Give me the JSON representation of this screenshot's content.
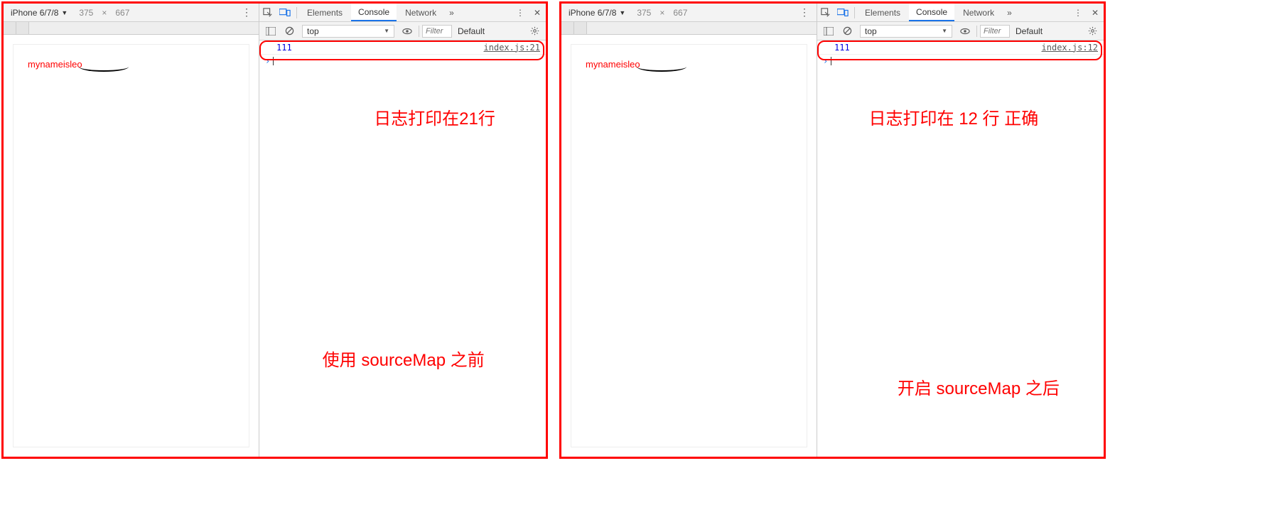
{
  "left": {
    "device_toolbar": {
      "device_name": "iPhone 6/7/8",
      "width": "375",
      "sep": "×",
      "height": "667"
    },
    "page_content": "mynameisleo",
    "devtools": {
      "tabs": {
        "elements": "Elements",
        "console": "Console",
        "network": "Network"
      },
      "context_select": "top",
      "filter_placeholder": "Filter",
      "level_label": "Default",
      "log": {
        "message": "111",
        "source": "index.js:21"
      }
    },
    "annotation_top": "日志打印在21行",
    "annotation_bottom": "使用 sourceMap 之前"
  },
  "right": {
    "device_toolbar": {
      "device_name": "iPhone 6/7/8",
      "width": "375",
      "sep": "×",
      "height": "667"
    },
    "page_content": "mynameisleo",
    "devtools": {
      "tabs": {
        "elements": "Elements",
        "console": "Console",
        "network": "Network"
      },
      "context_select": "top",
      "filter_placeholder": "Filter",
      "level_label": "Default",
      "log": {
        "message": "111",
        "source": "index.js:12"
      }
    },
    "annotation_top": "日志打印在 12 行 正确",
    "annotation_bottom": "开启 sourceMap 之后"
  }
}
